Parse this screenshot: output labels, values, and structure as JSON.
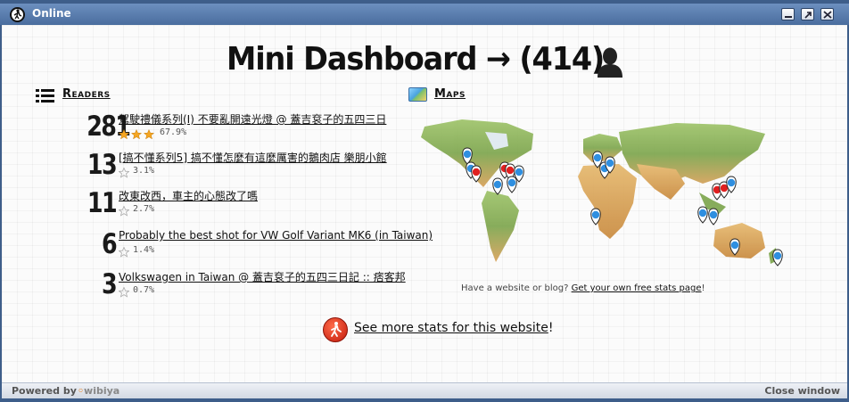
{
  "window": {
    "title": "Online"
  },
  "header": {
    "title": "Mini Dashboard → (414)"
  },
  "readers": {
    "heading": "Readers",
    "items": [
      {
        "count": "281",
        "title": "駕駛禮儀系列(I) 不要亂開遠光燈 @ 蓋吉袞子的五四三日",
        "percent": "67.9%",
        "stars": 3
      },
      {
        "count": "13",
        "title": "[搞不懂系列5] 搞不懂怎麼有這麼厲害的鵝肉店 樂朋小館",
        "percent": "3.1%",
        "stars": 0
      },
      {
        "count": "11",
        "title": "改東改西，車主的心態改了嗎",
        "percent": "2.7%",
        "stars": 0
      },
      {
        "count": "6",
        "title": "Probably the best shot for VW Golf Variant MK6 (in Taiwan)",
        "percent": "1.4%",
        "stars": 0
      },
      {
        "count": "3",
        "title": "Volkswagen in Taiwan @ 蓋吉袞子的五四三日記 :: 痞客邦",
        "percent": "0.7%",
        "stars": 0
      }
    ]
  },
  "maps": {
    "heading": "Maps",
    "caption_prefix": "Have a website or blog? ",
    "caption_link": "Get your own free stats page",
    "caption_suffix": "!"
  },
  "stats": {
    "link_text": "See more stats for this website",
    "suffix": "!"
  },
  "footer": {
    "powered_by": "Powered by",
    "brand": "wibiya",
    "close_label": "Close window"
  },
  "colors": {
    "titlebar": "#4a6d9e",
    "pin_blue": "#2f8fe0",
    "pin_red": "#e02020",
    "star": "#f5a623"
  }
}
